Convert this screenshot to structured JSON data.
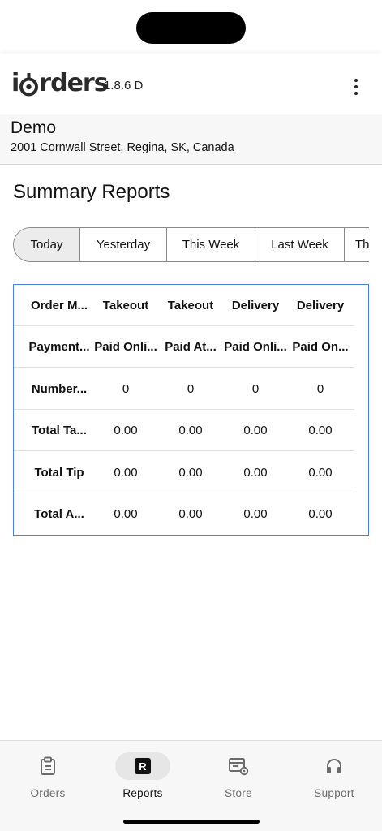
{
  "header": {
    "logo_text_prefix": "i",
    "logo_text_suffix": "rders",
    "version": "1.8.6 D",
    "menu_icon": "more-vertical-icon"
  },
  "store": {
    "name": "Demo",
    "address": "2001 Cornwall Street, Regina, SK, Canada"
  },
  "page": {
    "title": "Summary Reports"
  },
  "periods": [
    {
      "label": "Today",
      "active": true
    },
    {
      "label": "Yesterday",
      "active": false
    },
    {
      "label": "This Week",
      "active": false
    },
    {
      "label": "Last Week",
      "active": false
    },
    {
      "label": "Th",
      "active": false
    }
  ],
  "table": {
    "rows": [
      [
        "Order M...",
        "Takeout",
        "Takeout",
        "Delivery",
        "Delivery"
      ],
      [
        "Payment...",
        "Paid Onli...",
        "Paid At...",
        "Paid Onli...",
        "Paid On..."
      ],
      [
        "Number...",
        "0",
        "0",
        "0",
        "0"
      ],
      [
        "Total Ta...",
        "0.00",
        "0.00",
        "0.00",
        "0.00"
      ],
      [
        "Total Tip",
        "0.00",
        "0.00",
        "0.00",
        "0.00"
      ],
      [
        "Total A...",
        "0.00",
        "0.00",
        "0.00",
        "0.00"
      ]
    ]
  },
  "nav": [
    {
      "label": "Orders",
      "icon": "clipboard-icon",
      "active": false
    },
    {
      "label": "Reports",
      "icon": "reports-r-icon",
      "active": true
    },
    {
      "label": "Store",
      "icon": "store-settings-icon",
      "active": false
    },
    {
      "label": "Support",
      "icon": "headset-icon",
      "active": false
    }
  ],
  "colors": {
    "table_border": "#4a83d6",
    "active_segment": "#ececec",
    "nav_background": "#f7f7f7"
  }
}
